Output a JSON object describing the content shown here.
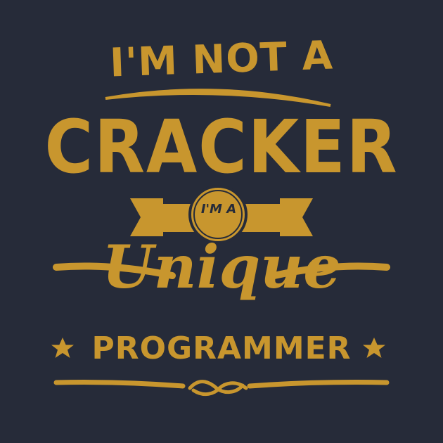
{
  "design": {
    "line1": "I'M NOT A",
    "line2": "CRACKER",
    "badge": "I'M A",
    "line4": "Unique",
    "line5": "PROGRAMMER"
  },
  "colors": {
    "background": "#262b39",
    "accent": "#c8962e"
  }
}
